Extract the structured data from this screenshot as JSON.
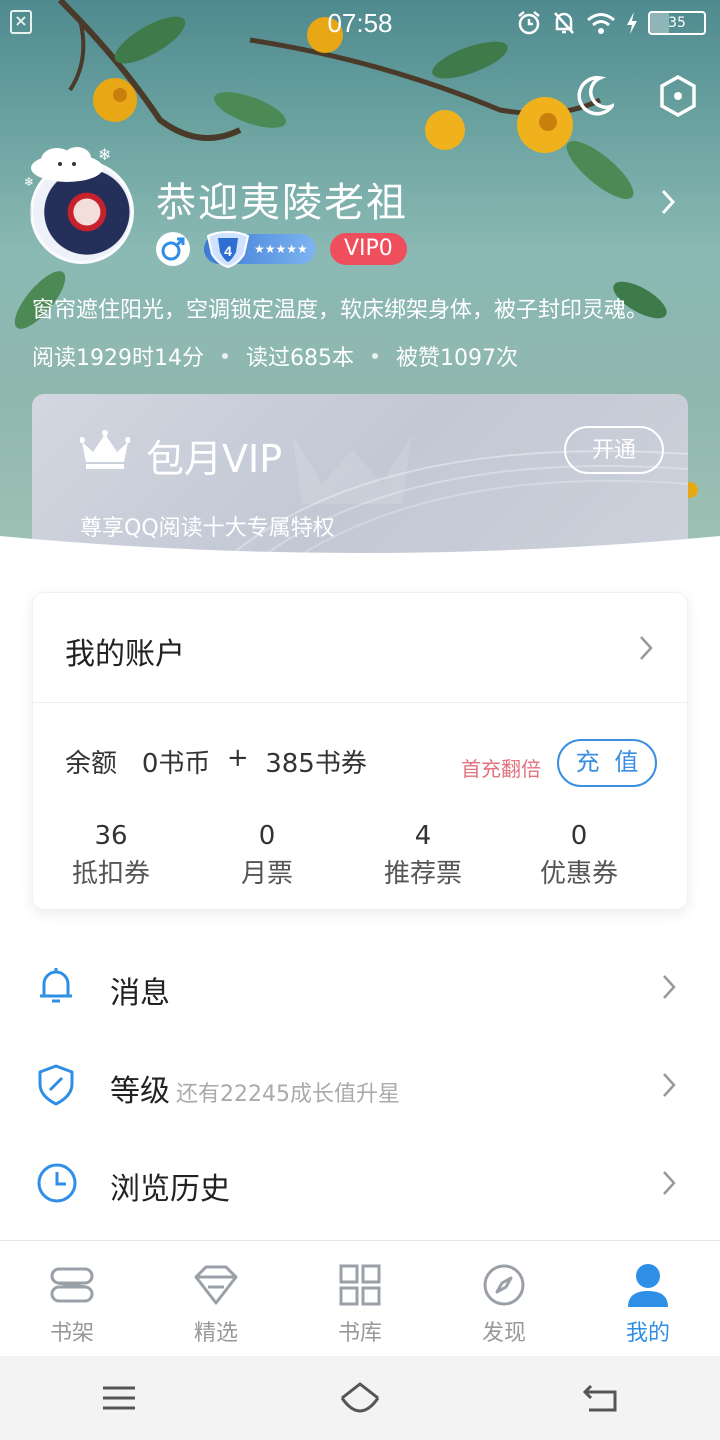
{
  "status_bar": {
    "time": "07:58",
    "battery_level": "35",
    "left_icon": "close-box-icon",
    "icons": [
      "alarm-icon",
      "mute-bell-icon",
      "wifi-icon",
      "charging-icon",
      "battery-icon"
    ]
  },
  "header": {
    "icons": [
      "night-mode-moon-icon",
      "settings-hexagon-icon"
    ],
    "username": "恭迎夷陵老祖",
    "gender": "male",
    "level": "4",
    "level_stars": "★★★★★",
    "vip_level": "VIP0",
    "signature": "窗帘遮住阳光，空调锁定温度，软床绑架身体，被子封印灵魂。",
    "stats": {
      "reading_time": "阅读1929时14分",
      "books_read": "读过685本",
      "likes": "被赞1097次"
    }
  },
  "vip_card": {
    "title": "包月VIP",
    "subtitle": "尊享QQ阅读十大专属特权",
    "button": "开通"
  },
  "account": {
    "title": "我的账户",
    "balance_label": "余额",
    "coins": "0书币",
    "plus": "+",
    "vouchers": "385书券",
    "first_charge": "首充翻倍",
    "recharge_button": "充 值",
    "tickets": [
      {
        "value": "36",
        "label": "抵扣券"
      },
      {
        "value": "0",
        "label": "月票"
      },
      {
        "value": "4",
        "label": "推荐票"
      },
      {
        "value": "0",
        "label": "优惠券"
      }
    ]
  },
  "menu": [
    {
      "label": "消息",
      "sub": "",
      "icon": "bell-icon"
    },
    {
      "label": "等级",
      "sub": "还有22245成长值升星",
      "icon": "shield-icon"
    },
    {
      "label": "浏览历史",
      "sub": "",
      "icon": "clock-icon"
    }
  ],
  "bottom_nav": [
    {
      "label": "书架",
      "icon": "bookshelf-icon",
      "active": false
    },
    {
      "label": "精选",
      "icon": "diamond-icon",
      "active": false
    },
    {
      "label": "书库",
      "icon": "grid-icon",
      "active": false
    },
    {
      "label": "发现",
      "icon": "compass-icon",
      "active": false
    },
    {
      "label": "我的",
      "icon": "person-icon",
      "active": true
    }
  ],
  "colors": {
    "accent": "#2f8fe6",
    "vip_red": "#ef4e5d",
    "first_charge": "#e0737d"
  }
}
